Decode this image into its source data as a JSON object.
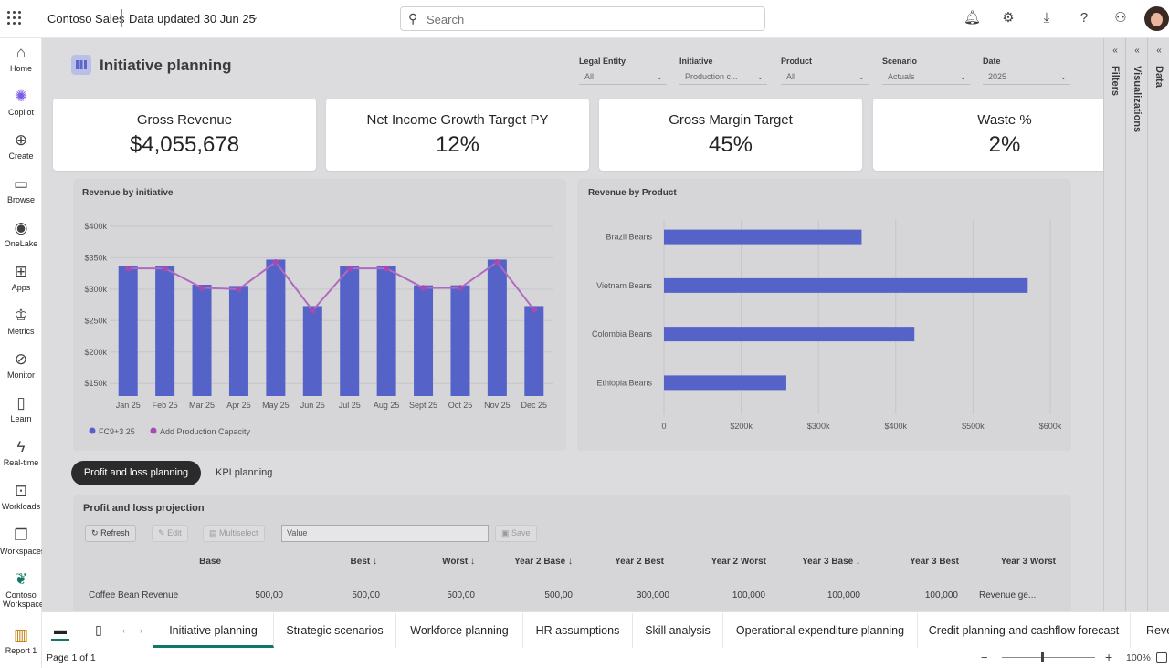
{
  "topbar": {
    "app_title": "Contoso Sales",
    "data_updated": "Data updated 30 Jun 25",
    "search_placeholder": "Search",
    "icons": [
      "bell-icon",
      "gear-icon",
      "download-icon",
      "help-icon",
      "share-people-icon"
    ]
  },
  "leftnav": {
    "items": [
      {
        "label": "Home",
        "icon": "⌂"
      },
      {
        "label": "Copilot",
        "icon": "✺"
      },
      {
        "label": "Create",
        "icon": "⊕"
      },
      {
        "label": "Browse",
        "icon": "▭"
      },
      {
        "label": "OneLake",
        "icon": "◉"
      },
      {
        "label": "Apps",
        "icon": "⊞"
      },
      {
        "label": "Metrics",
        "icon": "♔"
      },
      {
        "label": "Monitor",
        "icon": "⊘"
      },
      {
        "label": "Learn",
        "icon": "▯"
      },
      {
        "label": "Real-time",
        "icon": "ϟ"
      },
      {
        "label": "Workloads",
        "icon": "⊡"
      },
      {
        "label": "Workspaces",
        "icon": "❐"
      },
      {
        "label": "Contoso Workspace",
        "icon": "❦"
      },
      {
        "label": "Report 1",
        "icon": "▥"
      }
    ]
  },
  "report": {
    "title": "Initiative planning",
    "filters": [
      {
        "label": "Legal Entity",
        "value": "All"
      },
      {
        "label": "Initiative",
        "value": "Production c..."
      },
      {
        "label": "Product",
        "value": "All"
      },
      {
        "label": "Scenario",
        "value": "Actuals"
      },
      {
        "label": "Date",
        "value": "2025"
      }
    ],
    "kpis": [
      {
        "title": "Gross Revenue",
        "value": "$4,055,678"
      },
      {
        "title": "Net Income Growth Target PY",
        "value": "12%"
      },
      {
        "title": "Gross Margin Target",
        "value": "45%"
      },
      {
        "title": "Waste %",
        "value": "2%"
      }
    ],
    "tabs": {
      "active": "Profit and loss planning",
      "other": "KPI planning"
    },
    "pl": {
      "title": "Profit and loss projection",
      "toolbar": {
        "refresh": "Refresh",
        "edit": "Edit",
        "multiselect": "Multiselect",
        "value_placeholder": "Value",
        "save": "Save"
      },
      "columns": [
        "Base",
        "Best ↓",
        "Worst ↓",
        "Year 2 Base ↓",
        "Year 2 Best",
        "Year 2 Worst",
        "Year 3 Base ↓",
        "Year 3 Best",
        "Year 3 Worst"
      ],
      "row": {
        "name": "Coffee Bean Revenue",
        "cells": [
          "500,00",
          "500,00",
          "500,00",
          "500,00",
          "300,000",
          "100,000",
          "100,000",
          "100,000",
          "Revenue ge..."
        ]
      }
    }
  },
  "right_panel": {
    "panes": [
      "Filters",
      "Visualizations",
      "Data"
    ]
  },
  "chart_data": [
    {
      "type": "bar",
      "title": "Revenue by initiative",
      "categories": [
        "Jan 25",
        "Feb 25",
        "Mar 25",
        "Apr 25",
        "May 25",
        "Jun 25",
        "Jul 25",
        "Aug 25",
        "Sept 25",
        "Oct 25",
        "Nov 25",
        "Dec 25"
      ],
      "series": [
        {
          "name": "FC9+3 25",
          "type": "bar",
          "color": "#5563c9",
          "values": [
            336000,
            336000,
            307000,
            305000,
            347000,
            273000,
            336000,
            336000,
            306000,
            306000,
            347000,
            273000
          ]
        },
        {
          "name": "Add Production Capacity",
          "type": "line",
          "color": "#a64bb0",
          "values": [
            333000,
            333000,
            302000,
            300000,
            343000,
            266000,
            333000,
            333000,
            302000,
            302000,
            343000,
            267000
          ]
        }
      ],
      "ylim": [
        130000,
        410000
      ],
      "yticks": [
        "$150k",
        "$200k",
        "$250k",
        "$300k",
        "$350k",
        "$400k"
      ],
      "ytick_values": [
        150000,
        200000,
        250000,
        300000,
        350000,
        400000
      ],
      "grid": true,
      "legend": "bottom-left"
    },
    {
      "type": "bar",
      "orientation": "horizontal",
      "title": "Revenue by Product",
      "categories": [
        "Brazil Beans",
        "Vietnam Beans",
        "Colombia Beans",
        "Ethiopia Beans"
      ],
      "values": [
        307000,
        565000,
        389000,
        190000
      ],
      "color": "#5563c9",
      "xlim": [
        0,
        600000
      ],
      "xticks": [
        "0",
        "$200k",
        "$300k",
        "$400k",
        "$500k",
        "$600k"
      ],
      "xtick_values": [
        0,
        120000,
        240000,
        360000,
        480000,
        600000
      ],
      "grid": true
    }
  ],
  "bottom": {
    "page_tabs": [
      "Initiative planning",
      "Strategic scenarios",
      "Workforce planning",
      "HR assumptions",
      "Skill analysis",
      "Operational expenditure planning",
      "Credit planning and cashflow forecast",
      "Reve"
    ],
    "page_info": "Page 1 of 1",
    "zoom": "100%"
  }
}
